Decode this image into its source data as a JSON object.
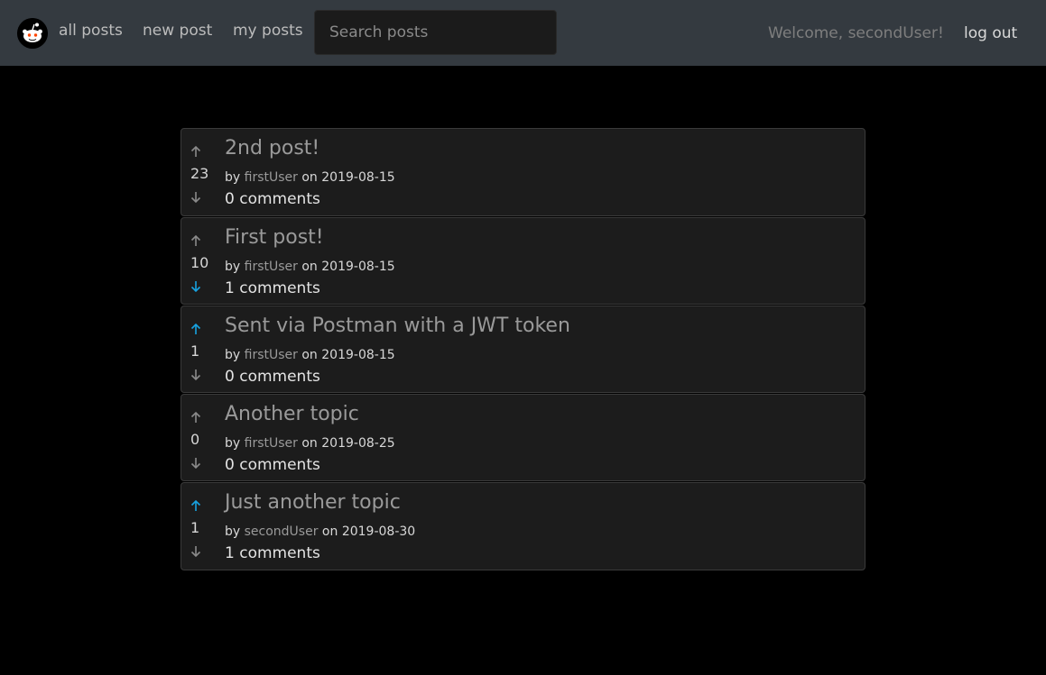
{
  "nav": {
    "logo_icon": "reddit-alien-icon",
    "links": [
      "all posts",
      "new post",
      "my posts"
    ],
    "search_placeholder": "Search posts",
    "welcome": "Welcome, secondUser!",
    "logout": "log out"
  },
  "colors": {
    "navbar_bg": "#343a40",
    "page_bg": "#000000",
    "card_bg": "#1c1c1c",
    "vote_active": "#17a2e0",
    "vote_inactive": "#8a8a8a"
  },
  "posts": [
    {
      "title": "2nd post!",
      "score": "23",
      "by": "by",
      "author": "firstUser",
      "on": "on",
      "date": "2019-08-15",
      "comments": "0 comments",
      "vote": "none"
    },
    {
      "title": "First post!",
      "score": "10",
      "by": "by",
      "author": "firstUser",
      "on": "on",
      "date": "2019-08-15",
      "comments": "1 comments",
      "vote": "down"
    },
    {
      "title": "Sent via Postman with a JWT token",
      "score": "1",
      "by": "by",
      "author": "firstUser",
      "on": "on",
      "date": "2019-08-15",
      "comments": "0 comments",
      "vote": "up"
    },
    {
      "title": "Another topic",
      "score": "0",
      "by": "by",
      "author": "firstUser",
      "on": "on",
      "date": "2019-08-25",
      "comments": "0 comments",
      "vote": "none"
    },
    {
      "title": "Just another topic",
      "score": "1",
      "by": "by",
      "author": "secondUser",
      "on": "on",
      "date": "2019-08-30",
      "comments": "1 comments",
      "vote": "up"
    }
  ]
}
